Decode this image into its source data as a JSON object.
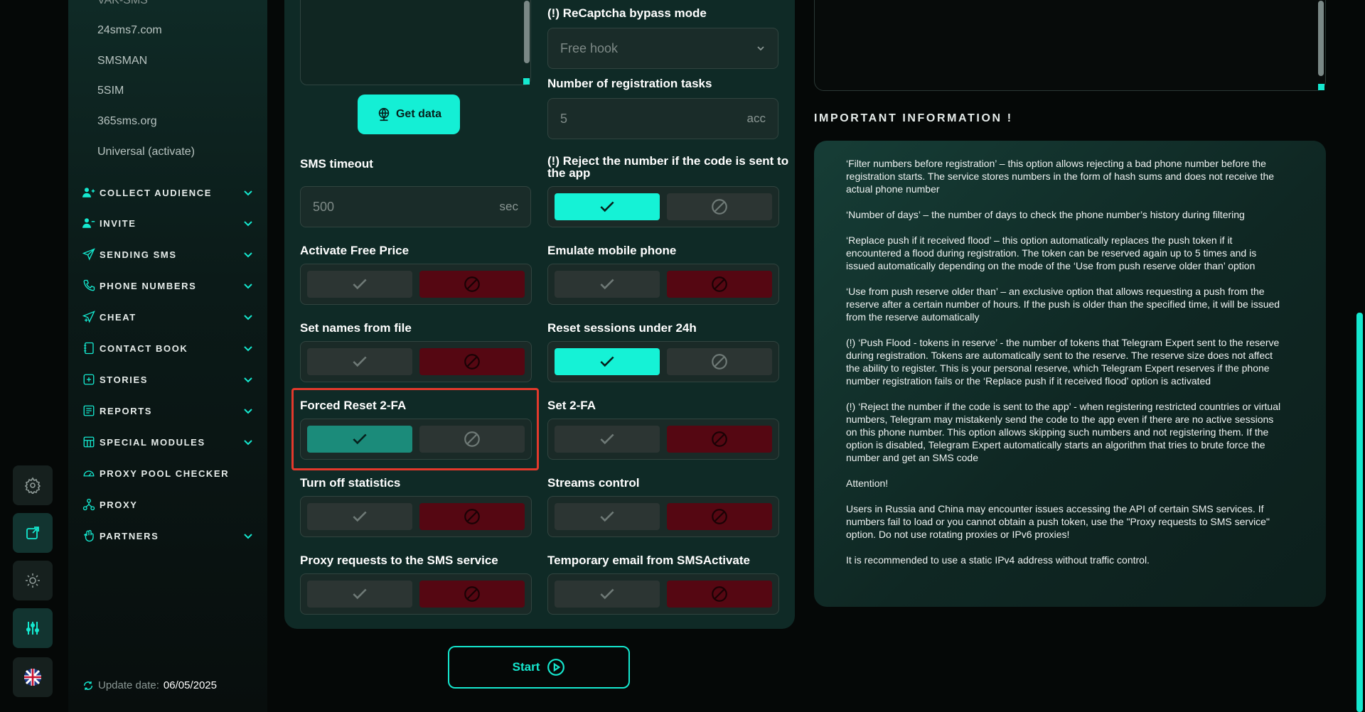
{
  "sidebar": {
    "sub_items": [
      "VAK-SMS",
      "24sms7.com",
      "SMSMAN",
      "5SIM",
      "365sms.org",
      "Universal (activate)"
    ],
    "menu": [
      {
        "label": "COLLECT AUDIENCE",
        "icon": "users-icon",
        "expandable": true
      },
      {
        "label": "INVITE",
        "icon": "user-plus-icon",
        "expandable": true
      },
      {
        "label": "SENDING SMS",
        "icon": "send-icon",
        "expandable": true
      },
      {
        "label": "PHONE NUMBERS",
        "icon": "phone-icon",
        "expandable": true
      },
      {
        "label": "CHEAT",
        "icon": "send-plus-icon",
        "expandable": true
      },
      {
        "label": "CONTACT BOOK",
        "icon": "book-icon",
        "expandable": true
      },
      {
        "label": "STORIES",
        "icon": "plus-square-icon",
        "expandable": true
      },
      {
        "label": "REPORTS",
        "icon": "report-icon",
        "expandable": true
      },
      {
        "label": "SPECIAL MODULES",
        "icon": "grid-icon",
        "expandable": true
      },
      {
        "label": "PROXY POOL CHECKER",
        "icon": "gauge-icon",
        "expandable": false
      },
      {
        "label": "PROXY",
        "icon": "network-icon",
        "expandable": false
      },
      {
        "label": "PARTNERS",
        "icon": "hand-icon",
        "expandable": true
      }
    ],
    "update_label": "Update date:",
    "update_value": "06/05/2025"
  },
  "form": {
    "get_data_label": "Get data",
    "recaptcha_label": "(!) ReCaptcha bypass mode",
    "recaptcha_value": "Free hook",
    "reg_tasks_label": "Number of registration tasks",
    "reg_tasks_value": "5",
    "reg_tasks_unit": "acc",
    "sms_timeout_label": "SMS timeout",
    "sms_timeout_value": "500",
    "sms_timeout_unit": "sec",
    "reject_label_line1": "(!) Reject the number if the code is sent to",
    "reject_label_line2": "the app",
    "toggles": [
      {
        "label": "Activate Free Price",
        "state": "off"
      },
      {
        "label": "Emulate mobile phone",
        "state": "off"
      },
      {
        "label": "Set names from file",
        "state": "off"
      },
      {
        "label": "Reset sessions under 24h",
        "state": "on"
      },
      {
        "label": "Forced Reset 2-FA",
        "state": "on"
      },
      {
        "label": "Set 2-FA",
        "state": "off"
      },
      {
        "label": "Turn off statistics",
        "state": "off"
      },
      {
        "label": "Streams control",
        "state": "off"
      },
      {
        "label": "Proxy requests to the SMS service",
        "state": "off"
      },
      {
        "label": "Temporary email from SMSActivate",
        "state": "off"
      }
    ],
    "reject_state": "on",
    "start_label": "Start"
  },
  "info": {
    "title": "IMPORTANT INFORMATION !",
    "paragraphs": [
      [
        "‘Filter numbers before registration’ – this option allows rejecting a bad phone number before the",
        "registration starts. The service stores numbers in the form of hash sums and does not receive the",
        "actual phone number"
      ],
      [
        "‘Number of days’ – the number of days to check the phone number’s history during filtering"
      ],
      [
        "‘Replace push if it received flood’ – this option automatically replaces the push token if it",
        "encountered a flood during registration. The token can be reserved again up to 5 times and is",
        "issued automatically depending on the mode of the ‘Use from push reserve older than’ option"
      ],
      [
        "‘Use from push reserve older than’ – an exclusive option that allows requesting a push from the",
        "reserve after a certain number of hours. If the push is older than the specified time, it will be issued",
        "from the reserve automatically"
      ],
      [
        "(!) ‘Push Flood - tokens in reserve’ - the number of tokens that Telegram Expert sent to the reserve",
        "during registration. Tokens are automatically sent to the reserve. The reserve size does not affect",
        "the ability to register. This is your personal reserve, which Telegram Expert reserves if the phone",
        "number registration fails or the ‘Replace push if it received flood’ option is activated"
      ],
      [
        "(!) ‘Reject the number if the code is sent to the app’ - when registering restricted countries or virtual",
        "numbers, Telegram may mistakenly send the code to the app even if there are no active sessions",
        "on this phone number. This option allows skipping such numbers and not registering them. If the",
        "option is disabled, Telegram Expert automatically starts an algorithm that tries to brute force the",
        "number and get an SMS code"
      ],
      [
        "Attention!"
      ],
      [
        "Users in Russia and China may encounter issues accessing the API of certain SMS services. If",
        "numbers fail to load or you cannot obtain a push token, use the \"Proxy requests to SMS service\"",
        "option. Do not use rotating proxies or IPv6 proxies!"
      ],
      [
        "It is recommended to use a static IPv4 address without traffic control."
      ]
    ]
  },
  "colors": {
    "accent": "#15efd5",
    "panel": "#0f2a26",
    "danger": "#550712",
    "highlight": "#e2392c"
  }
}
